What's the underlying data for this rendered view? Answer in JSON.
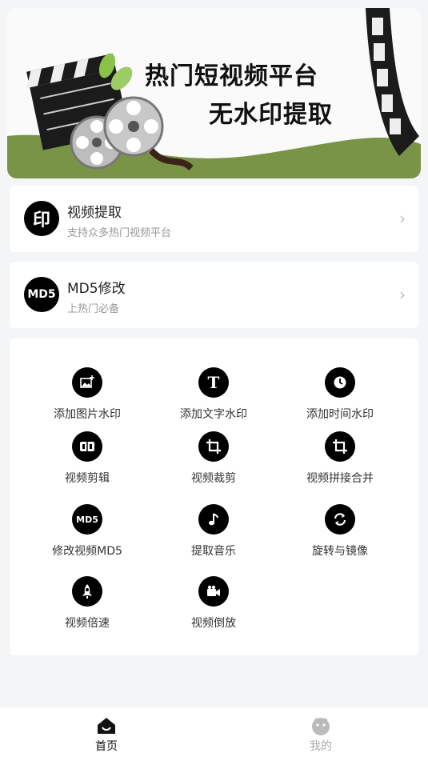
{
  "banner": {
    "line1": "热门短视频平台",
    "line2": "无水印提取"
  },
  "features": [
    {
      "icon": "印",
      "title": "视频提取",
      "subtitle": "支持众多热门视频平台"
    },
    {
      "icon": "MD5",
      "title": "MD5修改",
      "subtitle": "上热门必备"
    }
  ],
  "tools": [
    {
      "label": "添加图片水印",
      "icon": "image-plus-icon"
    },
    {
      "label": "添加文字水印",
      "icon": "text-t-icon"
    },
    {
      "label": "添加时间水印",
      "icon": "clock-icon"
    },
    {
      "label": "视频剪辑",
      "icon": "film-cut-icon"
    },
    {
      "label": "视频裁剪",
      "icon": "crop-icon"
    },
    {
      "label": "视频拼接合并",
      "icon": "crop-merge-icon"
    },
    {
      "label": "修改视频MD5",
      "icon": "md5-icon"
    },
    {
      "label": "提取音乐",
      "icon": "music-note-icon"
    },
    {
      "label": "旋转与镜像",
      "icon": "rotate-icon"
    },
    {
      "label": "视频倍速",
      "icon": "rocket-icon"
    },
    {
      "label": "视频倒放",
      "icon": "video-camera-icon"
    }
  ],
  "tabs": [
    {
      "label": "首页",
      "active": true
    },
    {
      "label": "我的",
      "active": false
    }
  ],
  "colors": {
    "banner_green": "#7a9447",
    "active_tab": "#111111",
    "inactive_tab": "#aaaaaa"
  }
}
